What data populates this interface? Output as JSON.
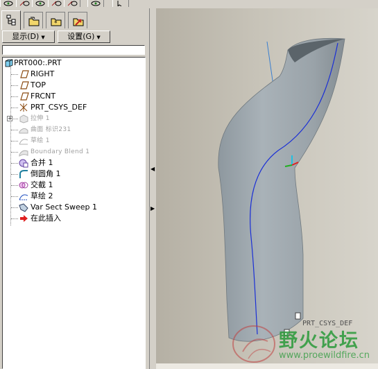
{
  "menu": {
    "display_label": "显示",
    "display_key": "(D)",
    "settings_label": "设置",
    "settings_key": "(G)"
  },
  "tree": {
    "root": "PRT000:.PRT",
    "items": [
      {
        "label": "RIGHT",
        "icon": "datum-plane-icon",
        "state": "normal"
      },
      {
        "label": "TOP",
        "icon": "datum-plane-icon",
        "state": "normal"
      },
      {
        "label": "FRCNT",
        "icon": "datum-plane-icon",
        "state": "normal"
      },
      {
        "label": "PRT_CSYS_DEF",
        "icon": "coordinate-system-icon",
        "state": "normal"
      },
      {
        "label": "拉伸 1",
        "icon": "extrude-icon",
        "state": "suppressed"
      },
      {
        "label": "曲面 标识231",
        "icon": "surface-icon",
        "state": "suppressed"
      },
      {
        "label": "草绘 1",
        "icon": "sketch-icon",
        "state": "suppressed"
      },
      {
        "label": "Boundary Blend 1",
        "icon": "boundary-blend-icon",
        "state": "suppressed"
      },
      {
        "label": "合并 1",
        "icon": "merge-icon",
        "state": "normal"
      },
      {
        "label": "倒圆角 1",
        "icon": "round-icon",
        "state": "normal"
      },
      {
        "label": "交截 1",
        "icon": "intersect-icon",
        "state": "normal"
      },
      {
        "label": "草绘 2",
        "icon": "sketch-icon",
        "state": "normal"
      },
      {
        "label": "Var Sect Sweep 1",
        "icon": "var-sect-sweep-icon",
        "state": "normal"
      },
      {
        "label": "在此插入",
        "icon": "insert-here-arrow-icon",
        "state": "normal"
      }
    ]
  },
  "viewport": {
    "csys_label": "PRT_CSYS_DEF",
    "watermark_cn": "野火论坛",
    "watermark_url": "www.proewildfire.cn"
  },
  "colors": {
    "panel": "#d4d0c8",
    "surface": "#a4adb3",
    "trajectory": "#1a2fd6",
    "watermark": "#2a9a3a"
  }
}
